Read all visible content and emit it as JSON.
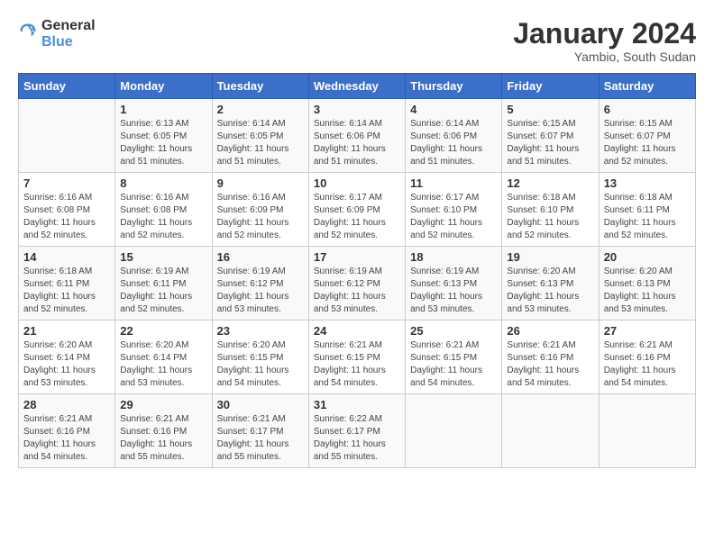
{
  "header": {
    "logo_general": "General",
    "logo_blue": "Blue",
    "month_title": "January 2024",
    "subtitle": "Yambio, South Sudan"
  },
  "days_of_week": [
    "Sunday",
    "Monday",
    "Tuesday",
    "Wednesday",
    "Thursday",
    "Friday",
    "Saturday"
  ],
  "weeks": [
    [
      {
        "day": "",
        "info": ""
      },
      {
        "day": "1",
        "info": "Sunrise: 6:13 AM\nSunset: 6:05 PM\nDaylight: 11 hours\nand 51 minutes."
      },
      {
        "day": "2",
        "info": "Sunrise: 6:14 AM\nSunset: 6:05 PM\nDaylight: 11 hours\nand 51 minutes."
      },
      {
        "day": "3",
        "info": "Sunrise: 6:14 AM\nSunset: 6:06 PM\nDaylight: 11 hours\nand 51 minutes."
      },
      {
        "day": "4",
        "info": "Sunrise: 6:14 AM\nSunset: 6:06 PM\nDaylight: 11 hours\nand 51 minutes."
      },
      {
        "day": "5",
        "info": "Sunrise: 6:15 AM\nSunset: 6:07 PM\nDaylight: 11 hours\nand 51 minutes."
      },
      {
        "day": "6",
        "info": "Sunrise: 6:15 AM\nSunset: 6:07 PM\nDaylight: 11 hours\nand 52 minutes."
      }
    ],
    [
      {
        "day": "7",
        "info": "Sunrise: 6:16 AM\nSunset: 6:08 PM\nDaylight: 11 hours\nand 52 minutes."
      },
      {
        "day": "8",
        "info": "Sunrise: 6:16 AM\nSunset: 6:08 PM\nDaylight: 11 hours\nand 52 minutes."
      },
      {
        "day": "9",
        "info": "Sunrise: 6:16 AM\nSunset: 6:09 PM\nDaylight: 11 hours\nand 52 minutes."
      },
      {
        "day": "10",
        "info": "Sunrise: 6:17 AM\nSunset: 6:09 PM\nDaylight: 11 hours\nand 52 minutes."
      },
      {
        "day": "11",
        "info": "Sunrise: 6:17 AM\nSunset: 6:10 PM\nDaylight: 11 hours\nand 52 minutes."
      },
      {
        "day": "12",
        "info": "Sunrise: 6:18 AM\nSunset: 6:10 PM\nDaylight: 11 hours\nand 52 minutes."
      },
      {
        "day": "13",
        "info": "Sunrise: 6:18 AM\nSunset: 6:11 PM\nDaylight: 11 hours\nand 52 minutes."
      }
    ],
    [
      {
        "day": "14",
        "info": "Sunrise: 6:18 AM\nSunset: 6:11 PM\nDaylight: 11 hours\nand 52 minutes."
      },
      {
        "day": "15",
        "info": "Sunrise: 6:19 AM\nSunset: 6:11 PM\nDaylight: 11 hours\nand 52 minutes."
      },
      {
        "day": "16",
        "info": "Sunrise: 6:19 AM\nSunset: 6:12 PM\nDaylight: 11 hours\nand 53 minutes."
      },
      {
        "day": "17",
        "info": "Sunrise: 6:19 AM\nSunset: 6:12 PM\nDaylight: 11 hours\nand 53 minutes."
      },
      {
        "day": "18",
        "info": "Sunrise: 6:19 AM\nSunset: 6:13 PM\nDaylight: 11 hours\nand 53 minutes."
      },
      {
        "day": "19",
        "info": "Sunrise: 6:20 AM\nSunset: 6:13 PM\nDaylight: 11 hours\nand 53 minutes."
      },
      {
        "day": "20",
        "info": "Sunrise: 6:20 AM\nSunset: 6:13 PM\nDaylight: 11 hours\nand 53 minutes."
      }
    ],
    [
      {
        "day": "21",
        "info": "Sunrise: 6:20 AM\nSunset: 6:14 PM\nDaylight: 11 hours\nand 53 minutes."
      },
      {
        "day": "22",
        "info": "Sunrise: 6:20 AM\nSunset: 6:14 PM\nDaylight: 11 hours\nand 53 minutes."
      },
      {
        "day": "23",
        "info": "Sunrise: 6:20 AM\nSunset: 6:15 PM\nDaylight: 11 hours\nand 54 minutes."
      },
      {
        "day": "24",
        "info": "Sunrise: 6:21 AM\nSunset: 6:15 PM\nDaylight: 11 hours\nand 54 minutes."
      },
      {
        "day": "25",
        "info": "Sunrise: 6:21 AM\nSunset: 6:15 PM\nDaylight: 11 hours\nand 54 minutes."
      },
      {
        "day": "26",
        "info": "Sunrise: 6:21 AM\nSunset: 6:16 PM\nDaylight: 11 hours\nand 54 minutes."
      },
      {
        "day": "27",
        "info": "Sunrise: 6:21 AM\nSunset: 6:16 PM\nDaylight: 11 hours\nand 54 minutes."
      }
    ],
    [
      {
        "day": "28",
        "info": "Sunrise: 6:21 AM\nSunset: 6:16 PM\nDaylight: 11 hours\nand 54 minutes."
      },
      {
        "day": "29",
        "info": "Sunrise: 6:21 AM\nSunset: 6:16 PM\nDaylight: 11 hours\nand 55 minutes."
      },
      {
        "day": "30",
        "info": "Sunrise: 6:21 AM\nSunset: 6:17 PM\nDaylight: 11 hours\nand 55 minutes."
      },
      {
        "day": "31",
        "info": "Sunrise: 6:22 AM\nSunset: 6:17 PM\nDaylight: 11 hours\nand 55 minutes."
      },
      {
        "day": "",
        "info": ""
      },
      {
        "day": "",
        "info": ""
      },
      {
        "day": "",
        "info": ""
      }
    ]
  ]
}
